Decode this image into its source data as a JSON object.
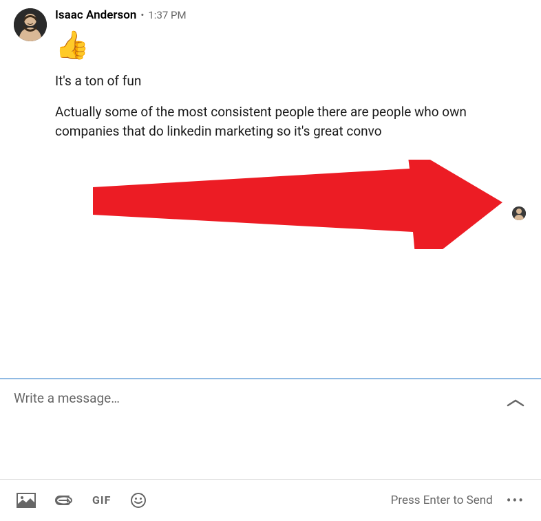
{
  "message": {
    "sender": "Isaac Anderson",
    "time": "1:37 PM",
    "emoji": "👍",
    "text1": "It's a ton of fun",
    "text2": "Actually some of the most consistent people there are people who own companies that do linkedin marketing so it's great convo"
  },
  "compose": {
    "placeholder": "Write a message…"
  },
  "toolbar": {
    "gif_label": "GIF",
    "send_hint": "Press Enter to Send",
    "more": "•••"
  },
  "arrow": {
    "color": "#EC1C24"
  }
}
